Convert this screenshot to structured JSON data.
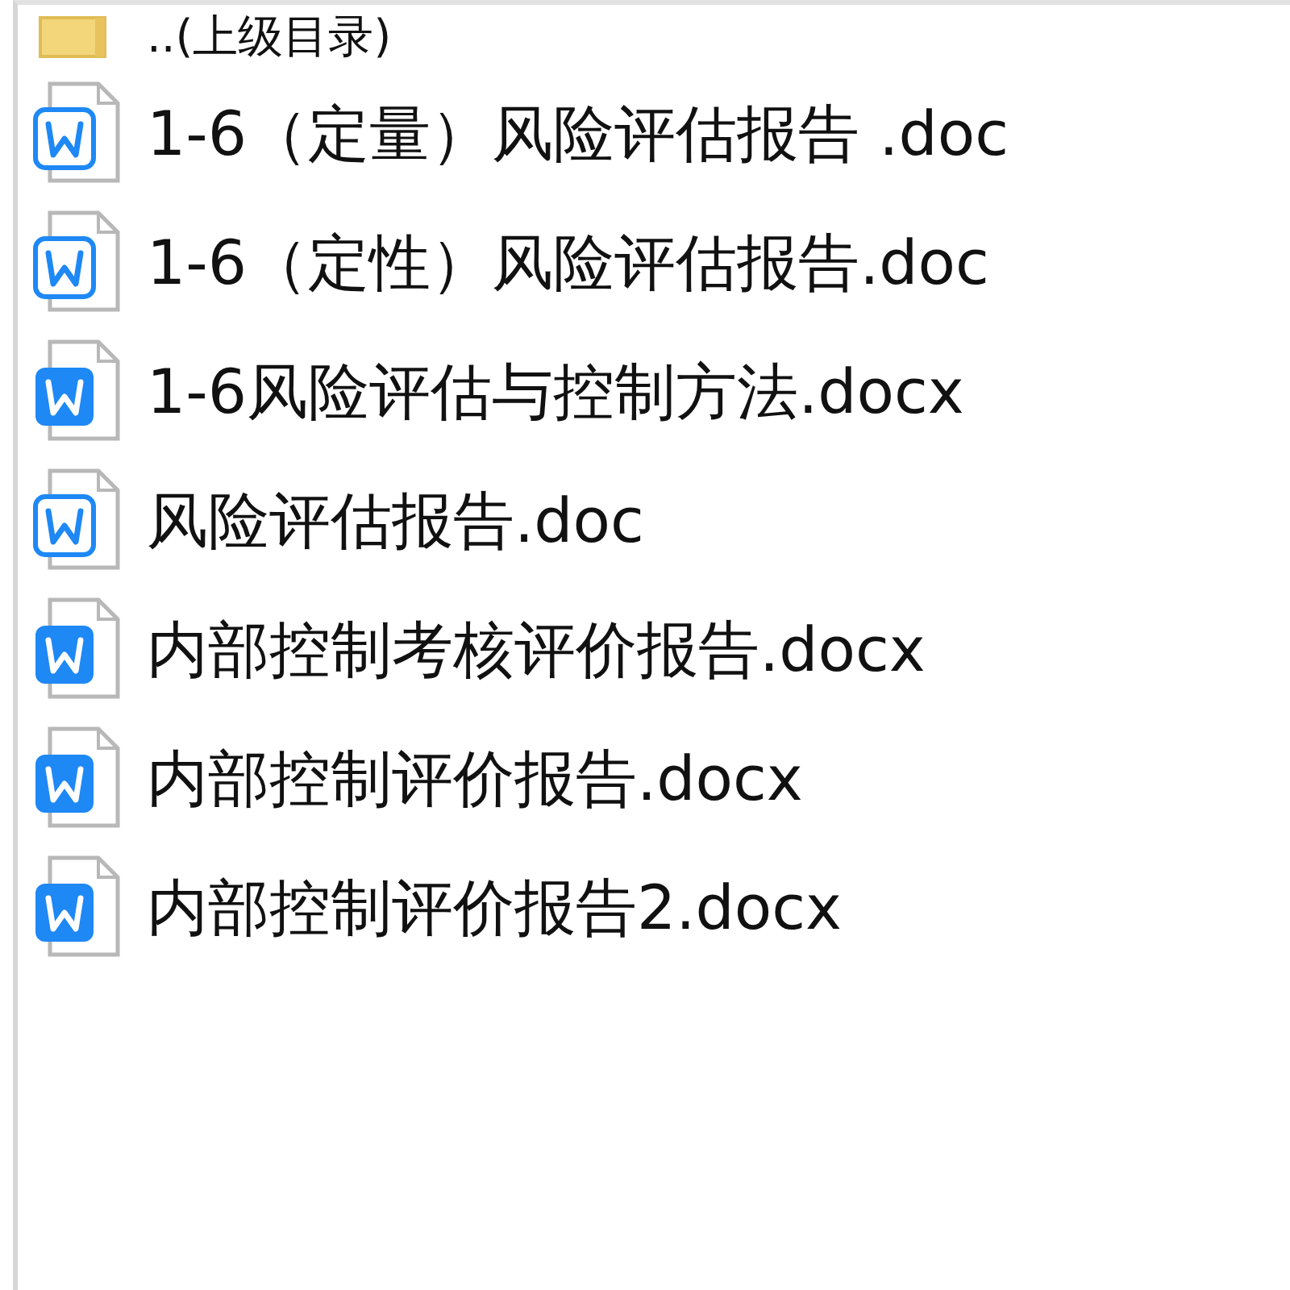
{
  "files": [
    {
      "kind": "folder",
      "name": "..(上级目录)"
    },
    {
      "kind": "doc",
      "name": "1-6（定量）风险评估报告 .doc"
    },
    {
      "kind": "doc",
      "name": "1-6（定性）风险评估报告.doc"
    },
    {
      "kind": "docx",
      "name": "1-6风险评估与控制方法.docx"
    },
    {
      "kind": "doc",
      "name": "风险评估报告.doc"
    },
    {
      "kind": "docx",
      "name": "内部控制考核评价报告.docx"
    },
    {
      "kind": "docx",
      "name": "内部控制评价报告.docx"
    },
    {
      "kind": "docx",
      "name": "内部控制评价报告2.docx"
    }
  ]
}
